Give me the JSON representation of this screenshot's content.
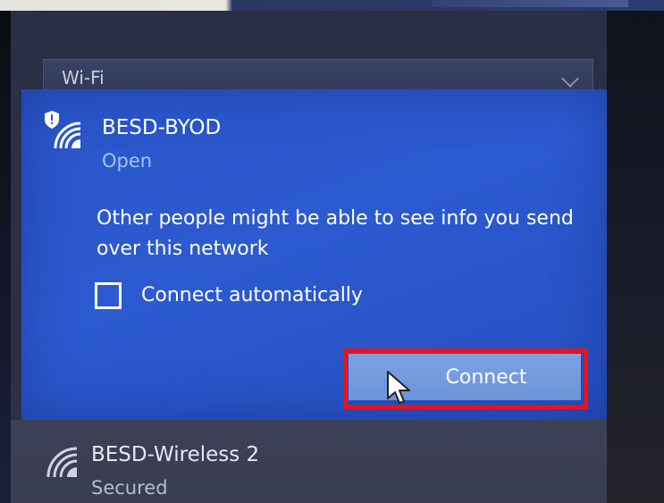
{
  "panel": {
    "section_label": "Wi-Fi"
  },
  "networks": [
    {
      "name": "BESD-BYOD",
      "status": "Open",
      "warning": "Other people might be able to see info you send over this network",
      "auto_connect_label": "Connect automatically",
      "auto_connect_checked": false,
      "connect_label": "Connect",
      "icon": "wifi-shield-icon"
    },
    {
      "name": "BESD-Wireless 2",
      "status": "Secured",
      "icon": "wifi-icon"
    }
  ],
  "colors": {
    "selected_bg": "#2a56c9",
    "status_text": "#9ec6ff",
    "connect_button": "#7da2e3",
    "highlight": "#e8131d"
  }
}
